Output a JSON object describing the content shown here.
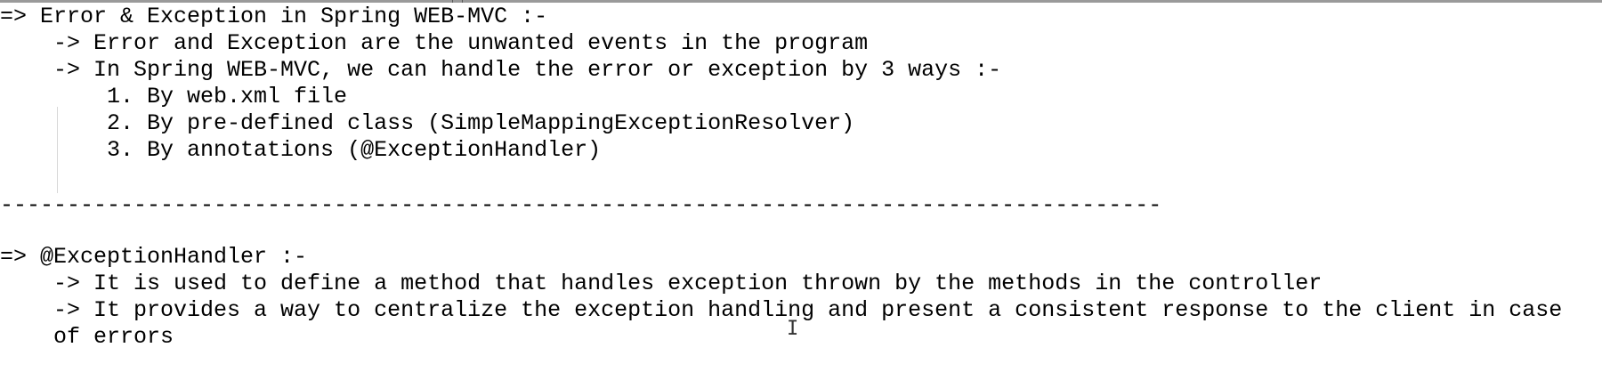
{
  "document": {
    "lines": {
      "l1": "=> Error & Exception in Spring WEB-MVC :-",
      "l2": "    -> Error and Exception are the unwanted events in the program",
      "l3": "    -> In Spring WEB-MVC, we can handle the error or exception by 3 ways :-",
      "l4": "        1. By web.xml file",
      "l5": "        2. By pre-defined class (SimpleMappingExceptionResolver)",
      "l6": "        3. By annotations (@ExceptionHandler)",
      "l7": "---------------------------------------------------------------------------------------",
      "l8": "=> @ExceptionHandler :-",
      "l9": "    -> It is used to define a method that handles exception thrown by the methods in the controller",
      "l10": "    -> It provides a way to centralize the exception handling and present a consistent response to the client in case",
      "l11": "    of errors"
    },
    "cursor_icon": "text-cursor-icon"
  }
}
